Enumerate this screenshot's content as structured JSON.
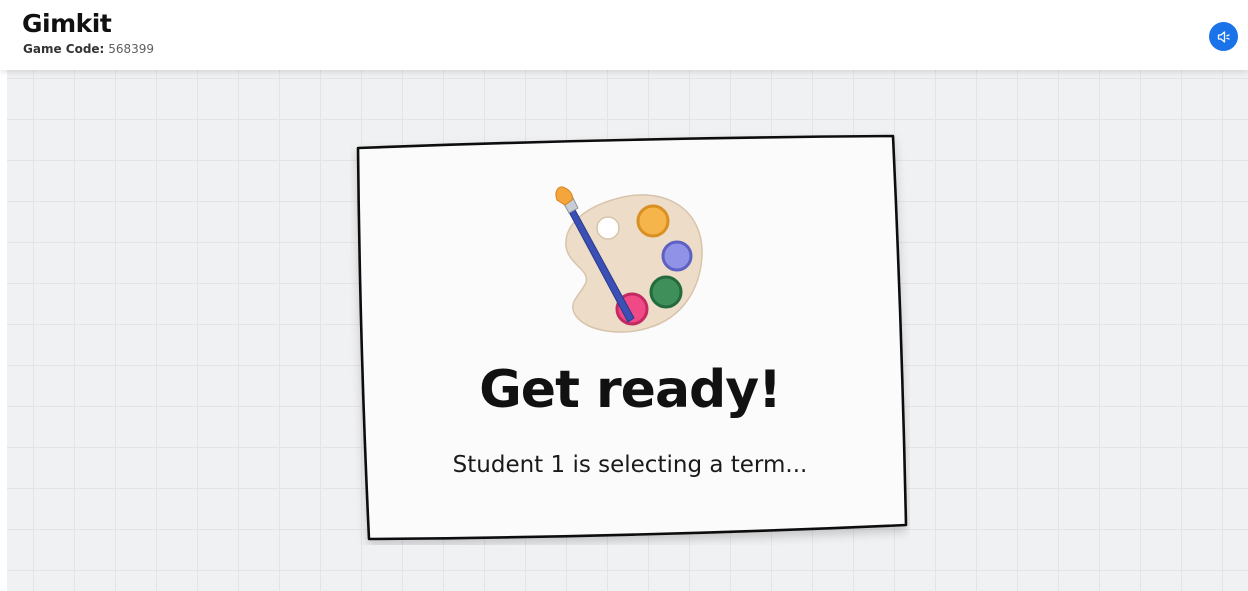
{
  "header": {
    "brand": "Gimkit",
    "game_code_label": "Game Code:",
    "game_code_value": "568399"
  },
  "controls": {
    "sound_icon": "speaker-icon"
  },
  "card": {
    "icon": "paint-palette-icon",
    "title": "Get ready!",
    "subtitle": "Student 1 is selecting a term..."
  },
  "colors": {
    "accent": "#1a73e8",
    "background": "#f0f1f3",
    "card": "#fbfbfb"
  }
}
